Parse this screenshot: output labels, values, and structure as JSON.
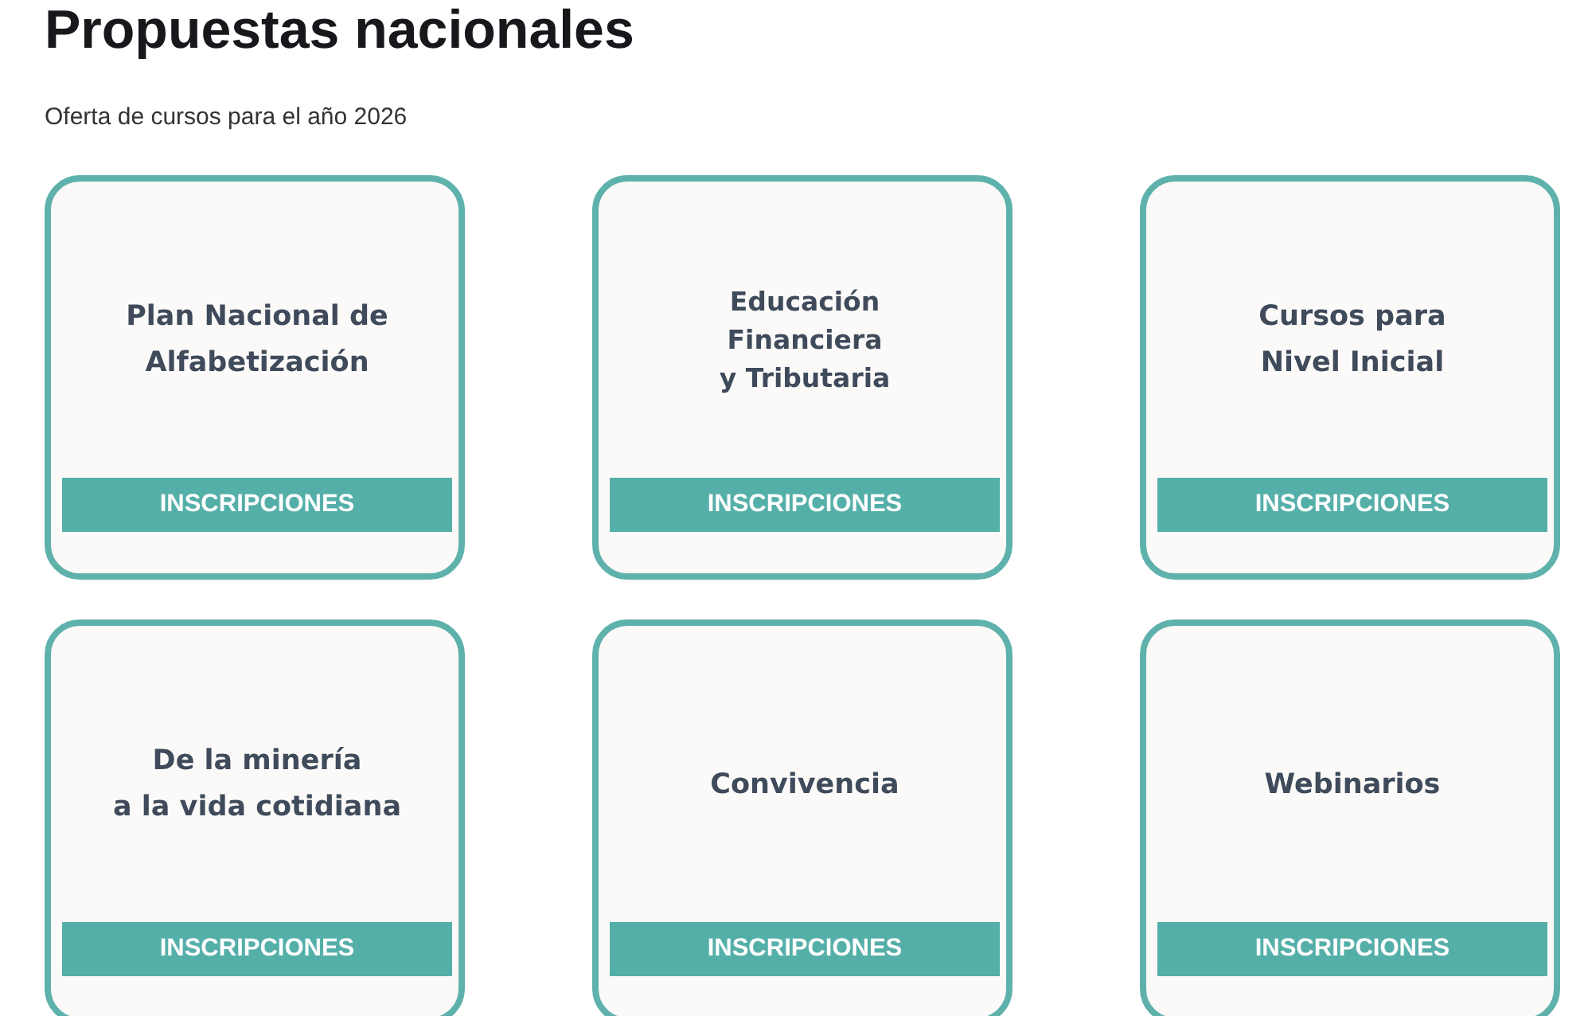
{
  "heading": "Propuestas nacionales",
  "subtitle": "Oferta de cursos para el año 2026",
  "courses": [
    {
      "title": "Plan Nacional de\nAlfabetización",
      "button": "INSCRIPCIONES"
    },
    {
      "title": "Educación\nFinanciera\ny Tributaria",
      "button": "INSCRIPCIONES"
    },
    {
      "title": "Cursos para\nNivel Inicial",
      "button": "INSCRIPCIONES"
    },
    {
      "title": "De la minería\na la vida cotidiana",
      "button": "INSCRIPCIONES"
    },
    {
      "title": "Convivencia",
      "button": "INSCRIPCIONES"
    },
    {
      "title": "Webinarios",
      "button": "INSCRIPCIONES"
    }
  ]
}
